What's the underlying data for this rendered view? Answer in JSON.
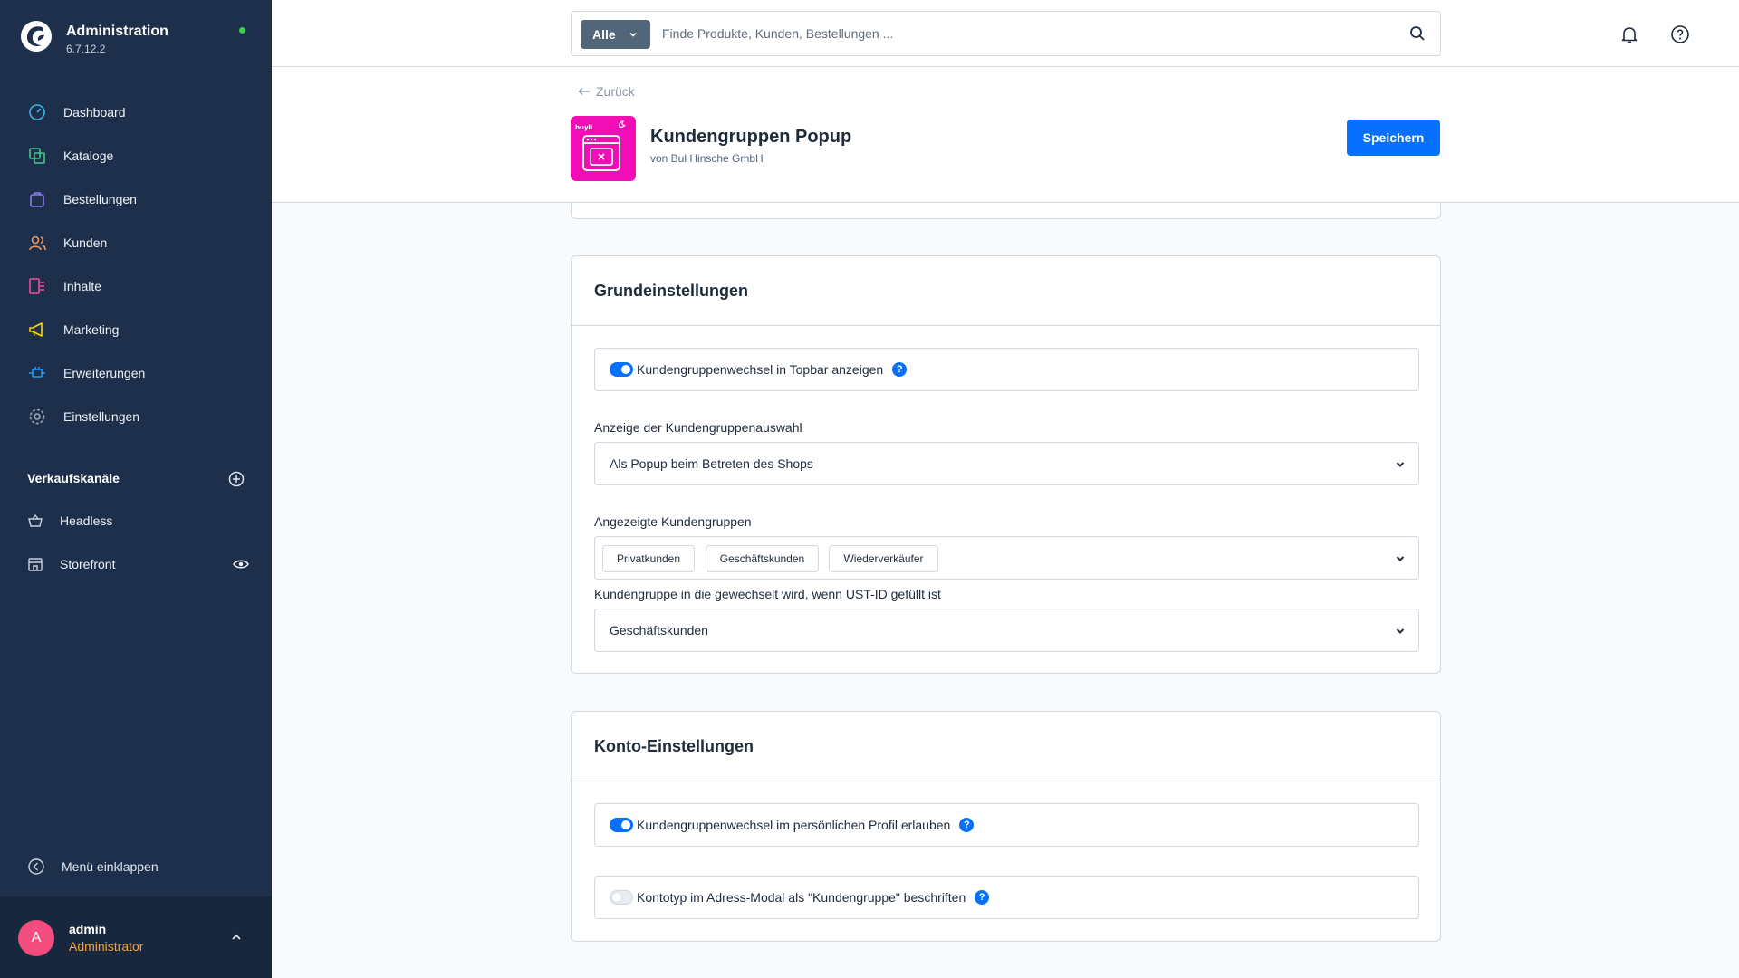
{
  "app": {
    "title": "Administration",
    "version": "6.7.12.2"
  },
  "nav": [
    {
      "label": "Dashboard",
      "icon": "dashboard-icon"
    },
    {
      "label": "Kataloge",
      "icon": "catalog-icon"
    },
    {
      "label": "Bestellungen",
      "icon": "orders-icon"
    },
    {
      "label": "Kunden",
      "icon": "customers-icon"
    },
    {
      "label": "Inhalte",
      "icon": "content-icon"
    },
    {
      "label": "Marketing",
      "icon": "marketing-icon"
    },
    {
      "label": "Erweiterungen",
      "icon": "extensions-icon"
    },
    {
      "label": "Einstellungen",
      "icon": "settings-icon"
    }
  ],
  "channels": {
    "title": "Verkaufskanäle",
    "items": [
      {
        "label": "Headless",
        "icon": "basket-icon"
      },
      {
        "label": "Storefront",
        "icon": "storefront-icon"
      }
    ]
  },
  "collapse_label": "Menü einklappen",
  "user": {
    "initial": "A",
    "name": "admin",
    "role": "Administrator"
  },
  "search": {
    "type_label": "Alle",
    "placeholder": "Finde Produkte, Kunden, Bestellungen ..."
  },
  "smartbar": {
    "back_label": "Zurück",
    "title": "Kundengruppen Popup",
    "vendor": "von Bul Hinsche GmbH",
    "save_label": "Speichern",
    "plugin_icon_text": "buyli"
  },
  "basic": {
    "title": "Grundeinstellungen",
    "toggle_topbar": {
      "label": "Kundengruppenwechsel in Topbar anzeigen",
      "on": true
    },
    "display_label": "Anzeige der Kundengruppenauswahl",
    "display_value": "Als Popup beim Betreten des Shops",
    "groups_label": "Angezeigte Kundengruppen",
    "groups": [
      "Privatkunden",
      "Geschäftskunden",
      "Wiederverkäufer"
    ],
    "vat_label": "Kundengruppe in die gewechselt wird, wenn UST-ID gefüllt ist",
    "vat_value": "Geschäftskunden"
  },
  "account": {
    "title": "Konto-Einstellungen",
    "toggle_profile": {
      "label": "Kundengruppenwechsel im persönlichen Profil erlauben",
      "on": true
    },
    "toggle_address": {
      "label": "Kontotyp im Adress-Modal als \"Kundengruppe\" beschriften",
      "on": false
    }
  },
  "help_glyph": "?",
  "colors": {
    "sidebar": "#1d2f4a",
    "accent": "#0870ff",
    "plugin": "#f10eb5",
    "role": "#f7a136",
    "avatar": "#f34d7f"
  }
}
